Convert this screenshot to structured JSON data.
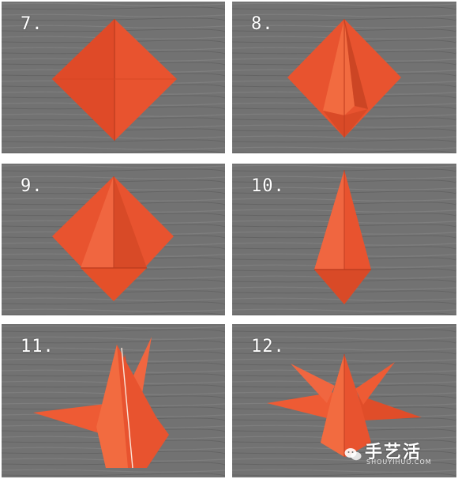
{
  "steps": [
    {
      "label": "7."
    },
    {
      "label": "8."
    },
    {
      "label": "9."
    },
    {
      "label": "10."
    },
    {
      "label": "11."
    },
    {
      "label": "12."
    }
  ],
  "watermark": {
    "title": "手艺活",
    "subtitle": "SHOUYIHUO.COM"
  },
  "colors": {
    "paper": "#e8532f",
    "paper_dark": "#c13e20",
    "table": "#6f6f6f"
  }
}
